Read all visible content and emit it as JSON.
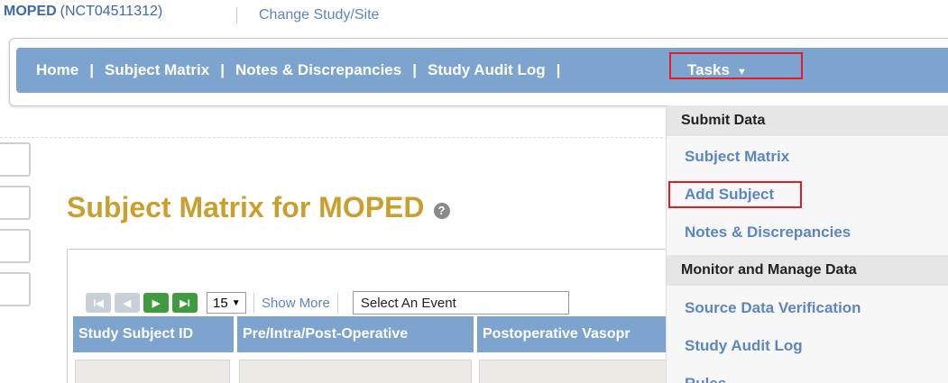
{
  "study": {
    "name": "MOPED",
    "id": "(NCT04511312)",
    "change_link": "Change Study/Site"
  },
  "nav": {
    "items": [
      "Home",
      "Subject Matrix",
      "Notes & Discrepancies",
      "Study Audit Log"
    ],
    "separator": "|",
    "tasks_label": "Tasks",
    "tasks_caret": "▼"
  },
  "page": {
    "title": "Subject Matrix for MOPED",
    "help_glyph": "?"
  },
  "pager": {
    "first": "I◀",
    "prev": "◀",
    "next": "▶",
    "last": "▶I",
    "page_size": "15",
    "show_more": "Show More",
    "event_select": "Select An Event"
  },
  "table": {
    "columns": [
      "Study Subject ID",
      "Pre/Intra/Post-Operative",
      "Postoperative Vasopr"
    ]
  },
  "tasks_menu": {
    "sections": [
      {
        "title": "Submit Data",
        "items": [
          "Subject Matrix",
          "Add Subject",
          "Notes & Discrepancies"
        ]
      },
      {
        "title": "Monitor and Manage Data",
        "items": [
          "Source Data Verification",
          "Study Audit Log",
          "Rules"
        ]
      }
    ]
  },
  "colors": {
    "nav_blue": "#7da3cf",
    "title_gold": "#c9a02d",
    "link_blue": "#5b86bf",
    "highlight_red": "#e01e26",
    "pager_green": "#3f9b3f"
  }
}
